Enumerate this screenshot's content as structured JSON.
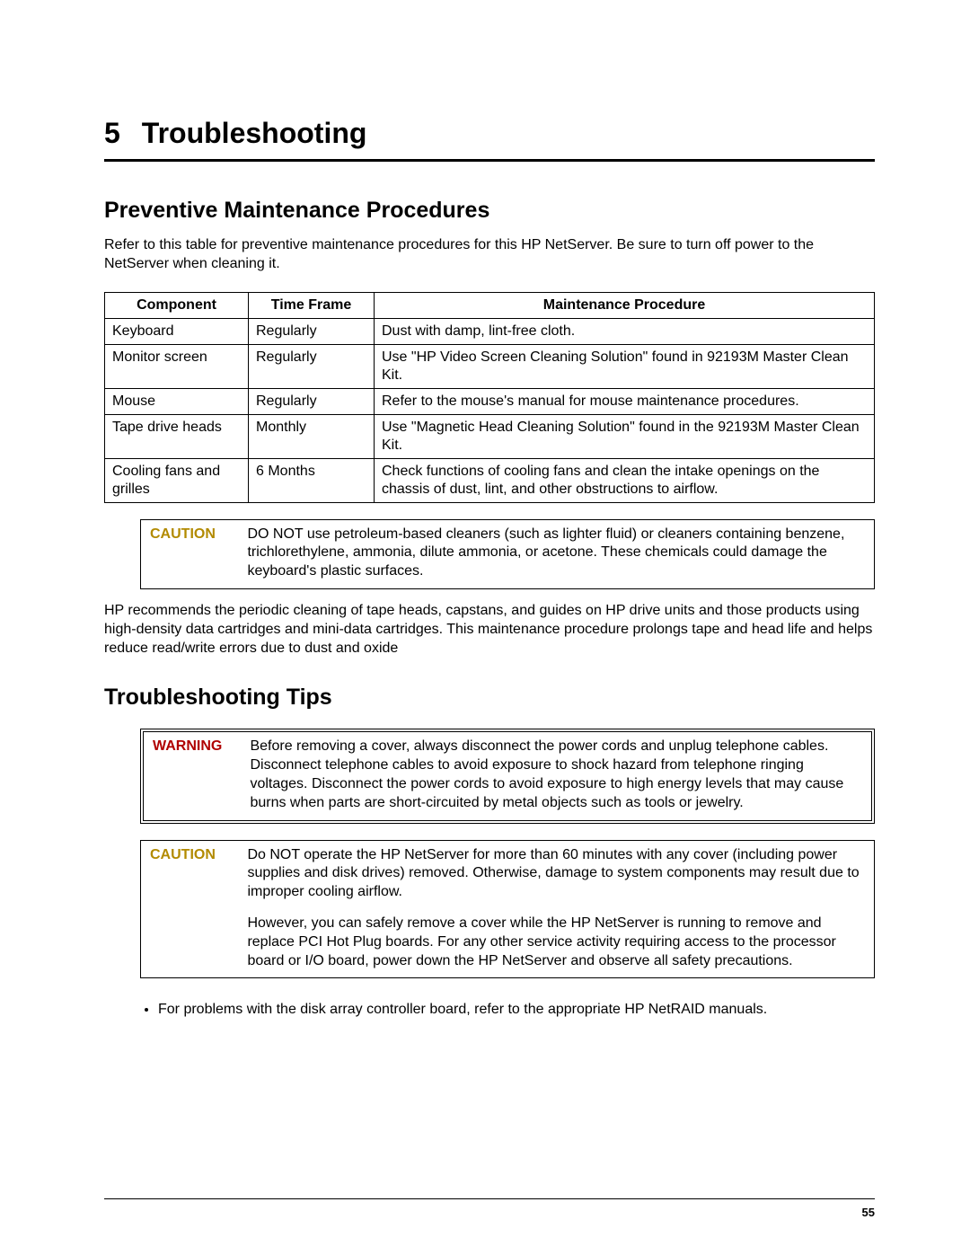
{
  "chapter": {
    "number": "5",
    "title": "Troubleshooting"
  },
  "section1": {
    "title": "Preventive Maintenance Procedures",
    "intro": "Refer to this table for preventive maintenance procedures for this HP NetServer. Be sure to turn off power to the NetServer when cleaning it."
  },
  "maint_table": {
    "headers": [
      "Component",
      "Time Frame",
      "Maintenance Procedure"
    ],
    "rows": [
      {
        "component": "Keyboard",
        "time": "Regularly",
        "procedure": "Dust with damp, lint-free cloth."
      },
      {
        "component": "Monitor screen",
        "time": "Regularly",
        "procedure": "Use \"HP Video Screen Cleaning Solution\" found in 92193M Master Clean Kit."
      },
      {
        "component": "Mouse",
        "time": "Regularly",
        "procedure": "Refer to the mouse's manual for mouse maintenance procedures."
      },
      {
        "component": "Tape drive heads",
        "time": "Monthly",
        "procedure": "Use \"Magnetic Head Cleaning Solution\" found in the 92193M Master Clean Kit."
      },
      {
        "component": "Cooling fans and grilles",
        "time": "6 Months",
        "procedure": "Check functions of cooling fans and clean the intake openings on the chassis of dust, lint, and other obstructions to airflow."
      }
    ]
  },
  "caution1": {
    "label": "CAUTION",
    "text": "DO NOT use petroleum-based cleaners (such as lighter fluid) or cleaners containing benzene, trichlorethylene, ammonia, dilute ammonia, or acetone. These chemicals could damage the keyboard's plastic surfaces."
  },
  "para_after_caution": "HP recommends the periodic cleaning of tape heads, capstans, and guides on HP drive units and those products using high-density data cartridges and mini-data cartridges. This maintenance procedure prolongs tape and head life and helps reduce read/write errors due to dust and oxide",
  "section2": {
    "title": "Troubleshooting Tips"
  },
  "warning1": {
    "label": "WARNING",
    "text": "Before removing a cover, always disconnect the power cords and unplug telephone cables. Disconnect telephone cables to avoid exposure to shock hazard from telephone ringing voltages. Disconnect the power cords to avoid exposure to high energy levels that may cause burns when parts are short-circuited by metal objects such as tools or jewelry."
  },
  "caution2": {
    "label": "CAUTION",
    "text1": "Do NOT operate the HP NetServer for more than 60 minutes with any cover (including power supplies and disk drives) removed. Otherwise, damage to system components may result due to improper cooling airflow.",
    "text2": "However, you can safely remove a cover while the HP NetServer is running to remove and replace PCI Hot Plug boards. For any other service activity requiring access to the processor board or I/O board, power down the HP NetServer and observe all safety precautions."
  },
  "bullets": [
    "For problems with the disk array controller board, refer to the appropriate HP NetRAID manuals."
  ],
  "page_number": "55"
}
